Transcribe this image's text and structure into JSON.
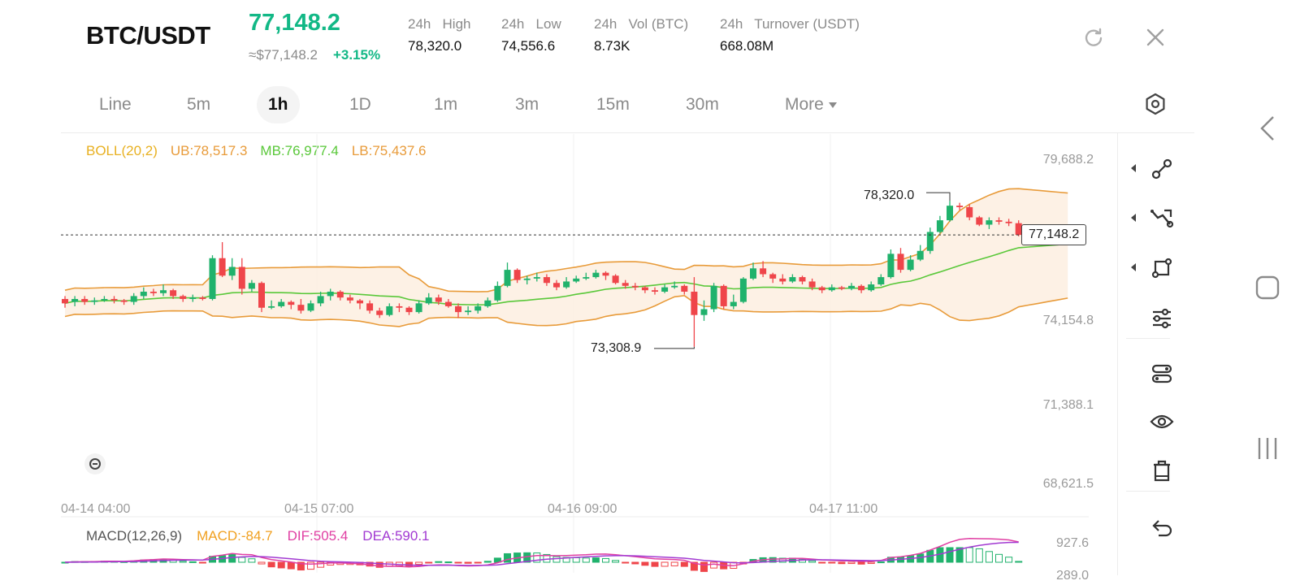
{
  "header": {
    "pair": "BTC/USDT",
    "price": "77,148.2",
    "approx_price": "≈$77,148.2",
    "change_pct": "+3.15%",
    "stats": [
      {
        "label": "24h   High",
        "value": "78,320.0"
      },
      {
        "label": "24h   Low",
        "value": "74,556.6"
      },
      {
        "label": "24h   Vol (BTC)",
        "value": "8.73K"
      },
      {
        "label": "24h   Turnover (USDT)",
        "value": "668.08M"
      }
    ],
    "refresh_icon": "refresh-icon",
    "close_icon": "close-icon"
  },
  "timeframes": {
    "items": [
      "Line",
      "5m",
      "1h",
      "1D",
      "1m",
      "3m",
      "15m",
      "30m",
      "More"
    ],
    "active": "1h",
    "settings_icon": "hexagon-settings-icon"
  },
  "indicator_boll": {
    "name": "BOLL(20,2)",
    "ub": "UB:78,517.3",
    "mb": "MB:76,977.4",
    "lb": "LB:75,437.6"
  },
  "indicator_macd": {
    "name": "MACD(12,26,9)",
    "macd": "MACD:-84.7",
    "dif": "DIF:505.4",
    "dea": "DEA:590.1"
  },
  "colors": {
    "up": "#20b26c",
    "down": "#ef454a",
    "boll_ub_lb": "#e89b3a",
    "boll_mb": "#5ac83a",
    "band_fill": "#fdeede",
    "boll_label": "#e8b020",
    "dif": "#e03fa3",
    "dea": "#a23ad2",
    "macd_label": "#f0a020"
  },
  "chart_data": {
    "type": "candlestick",
    "y_ticks": [
      "79,688.2",
      "74,154.8",
      "71,388.1",
      "68,621.5"
    ],
    "x_ticks": [
      "04-14 04:00",
      "04-15 07:00",
      "04-16 09:00",
      "04-17 11:00"
    ],
    "ylim": [
      68621.5,
      79688.2
    ],
    "high_label": "78,320.0",
    "low_label": "73,308.9",
    "current_price_label": "77,148.2",
    "macd_ticks": [
      "927.6",
      "289.0"
    ],
    "candles": [
      [
        74950,
        74800,
        75050,
        74650
      ],
      [
        74850,
        74950,
        75050,
        74700
      ],
      [
        74950,
        74850,
        75050,
        74750
      ],
      [
        74850,
        74900,
        75000,
        74750
      ],
      [
        74900,
        74950,
        75050,
        74850
      ],
      [
        74950,
        74900,
        75050,
        74800
      ],
      [
        74900,
        74850,
        74950,
        74750
      ],
      [
        74850,
        75050,
        75150,
        74750
      ],
      [
        75050,
        75200,
        75350,
        74950
      ],
      [
        75200,
        75150,
        75300,
        75050
      ],
      [
        75150,
        75250,
        75450,
        75050
      ],
      [
        75250,
        75050,
        75300,
        74950
      ],
      [
        75050,
        74950,
        75100,
        74850
      ],
      [
        74950,
        75000,
        75100,
        74850
      ],
      [
        75000,
        74950,
        75050,
        74900
      ],
      [
        74950,
        76350,
        76450,
        74900
      ],
      [
        76350,
        75750,
        76900,
        75700
      ],
      [
        75750,
        76050,
        76350,
        75600
      ],
      [
        76050,
        75300,
        76350,
        75100
      ],
      [
        75300,
        75500,
        75600,
        75200
      ],
      [
        75500,
        74650,
        75550,
        74500
      ],
      [
        74650,
        74700,
        74900,
        74600
      ],
      [
        74700,
        74850,
        74950,
        74650
      ],
      [
        74850,
        74750,
        74900,
        74600
      ],
      [
        74750,
        74550,
        74950,
        74450
      ],
      [
        74550,
        74800,
        74900,
        74500
      ],
      [
        74800,
        75050,
        75200,
        74700
      ],
      [
        75050,
        75200,
        75300,
        74900
      ],
      [
        75200,
        75000,
        75250,
        74900
      ],
      [
        75000,
        74900,
        75100,
        74800
      ],
      [
        74900,
        74800,
        74950,
        74600
      ],
      [
        74800,
        74550,
        74900,
        74450
      ],
      [
        74550,
        74400,
        74650,
        74300
      ],
      [
        74400,
        74700,
        74800,
        74350
      ],
      [
        74700,
        74650,
        74800,
        74500
      ],
      [
        74650,
        74500,
        74700,
        74400
      ],
      [
        74500,
        74800,
        74900,
        74450
      ],
      [
        74800,
        75000,
        75150,
        74750
      ],
      [
        75000,
        74850,
        75100,
        74750
      ],
      [
        74850,
        74700,
        74950,
        74650
      ],
      [
        74700,
        74500,
        74800,
        74300
      ],
      [
        74500,
        74550,
        74700,
        74400
      ],
      [
        74550,
        74700,
        74800,
        74450
      ],
      [
        74700,
        74900,
        75000,
        74650
      ],
      [
        74900,
        75400,
        75550,
        74850
      ],
      [
        75400,
        75950,
        76200,
        75350
      ],
      [
        75950,
        75600,
        76000,
        75500
      ],
      [
        75600,
        75650,
        75750,
        75450
      ],
      [
        75650,
        75700,
        75850,
        75550
      ],
      [
        75700,
        75500,
        75800,
        75400
      ],
      [
        75500,
        75350,
        75600,
        75250
      ],
      [
        75350,
        75550,
        75700,
        75300
      ],
      [
        75550,
        75650,
        75750,
        75500
      ],
      [
        75650,
        75700,
        75850,
        75600
      ],
      [
        75700,
        75850,
        75950,
        75650
      ],
      [
        75850,
        75750,
        75900,
        75600
      ],
      [
        75750,
        75500,
        75800,
        75450
      ],
      [
        75500,
        75400,
        75600,
        75300
      ],
      [
        75400,
        75350,
        75500,
        75250
      ],
      [
        75350,
        75250,
        75400,
        75150
      ],
      [
        75250,
        75200,
        75350,
        75100
      ],
      [
        75200,
        75350,
        75450,
        75150
      ],
      [
        75350,
        75400,
        75550,
        75300
      ],
      [
        75400,
        75200,
        75450,
        75100
      ],
      [
        75200,
        74400,
        75700,
        73309
      ],
      [
        74400,
        74600,
        74900,
        74200
      ],
      [
        74600,
        75400,
        75500,
        74500
      ],
      [
        75400,
        74700,
        75450,
        74600
      ],
      [
        74700,
        74850,
        75100,
        74600
      ],
      [
        74850,
        75650,
        75700,
        74800
      ],
      [
        75650,
        76000,
        76200,
        75600
      ],
      [
        76000,
        75800,
        76250,
        75700
      ],
      [
        75800,
        75650,
        75850,
        75500
      ],
      [
        75650,
        75550,
        75800,
        75450
      ],
      [
        75550,
        75700,
        75800,
        75500
      ],
      [
        75700,
        75550,
        75750,
        75450
      ],
      [
        75550,
        75350,
        75650,
        75250
      ],
      [
        75350,
        75250,
        75400,
        75150
      ],
      [
        75250,
        75350,
        75450,
        75200
      ],
      [
        75350,
        75300,
        75400,
        75250
      ],
      [
        75300,
        75400,
        75500,
        75250
      ],
      [
        75400,
        75250,
        75450,
        75150
      ],
      [
        75250,
        75450,
        75550,
        75200
      ],
      [
        75450,
        75700,
        75800,
        75400
      ],
      [
        75700,
        76500,
        76650,
        75650
      ],
      [
        76500,
        75950,
        76700,
        75850
      ],
      [
        75950,
        76300,
        76450,
        75900
      ],
      [
        76300,
        76600,
        76800,
        76250
      ],
      [
        76600,
        77250,
        77400,
        76500
      ],
      [
        77250,
        77650,
        77800,
        77200
      ],
      [
        77650,
        78150,
        78320,
        77600
      ],
      [
        78150,
        78100,
        78250,
        78000
      ],
      [
        78100,
        77750,
        78200,
        77650
      ],
      [
        77750,
        77500,
        77800,
        77450
      ],
      [
        77500,
        77650,
        77750,
        77350
      ],
      [
        77650,
        77600,
        77750,
        77500
      ],
      [
        77600,
        77550,
        77700,
        77450
      ],
      [
        77550,
        77148,
        77650,
        77100
      ]
    ]
  },
  "toolbar": {
    "tools": [
      "line-tool-icon",
      "trend-tool-icon",
      "shape-tool-icon",
      "indicator-sliders-icon",
      "template-icon",
      "eye-icon",
      "trash-icon",
      "undo-icon"
    ]
  },
  "system_nav": {
    "back": "back-chevron-icon",
    "home": "home-square-icon",
    "recents": "recents-lines-icon"
  }
}
